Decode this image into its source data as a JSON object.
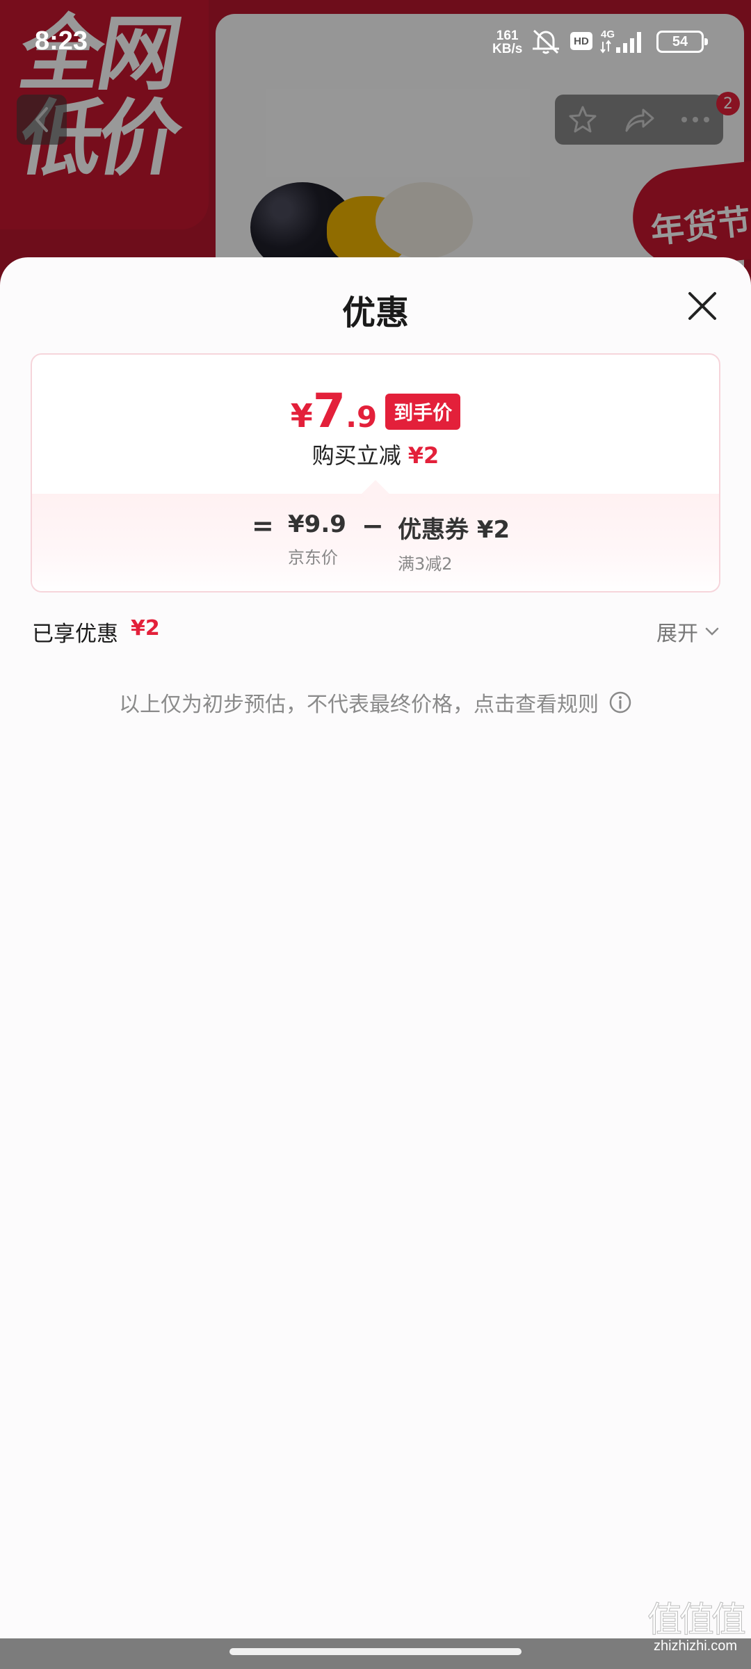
{
  "status_bar": {
    "time": "8:23",
    "network_rate_value": "161",
    "network_rate_unit": "KB/s",
    "hd": "HD",
    "network_type": "4G",
    "battery": "54"
  },
  "background_page": {
    "banner_text": [
      "全网",
      "低价"
    ],
    "festival_badge": "年货节",
    "cart_count": "2"
  },
  "sheet": {
    "title": "优惠",
    "price_card": {
      "final_price": {
        "currency": "¥",
        "integer": "7",
        "decimal": ".9"
      },
      "final_price_badge": "到手价",
      "instant_discount_label": "购买立减",
      "instant_discount_amount": "¥2",
      "breakdown": {
        "equals_sign": "=",
        "minus_sign": "−",
        "jd_price_value": "¥9.9",
        "jd_price_label": "京东价",
        "coupon_value": "优惠券 ¥2",
        "coupon_label": "满3减2"
      }
    },
    "enjoyed_label": "已享优惠",
    "enjoyed_amount": "¥2",
    "expand_label": "展开",
    "disclaimer": "以上仅为初步预估，不代表最终价格，点击查看规则"
  },
  "watermark": {
    "mark": "值值值",
    "site": "zhizhizhi.com"
  },
  "colors": {
    "accent_red": "#e3203a",
    "sheet_background": "#fcfbfc",
    "card_border": "#f6d5db"
  }
}
